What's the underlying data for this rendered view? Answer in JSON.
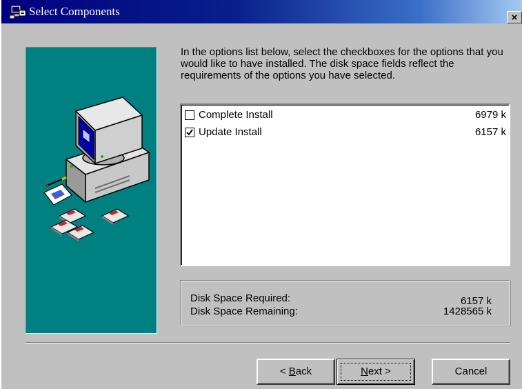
{
  "window": {
    "title": "Select Components",
    "close_label": "×",
    "icon": "installer-app-icon"
  },
  "instructions": "In the options list below, select the checkboxes for the options that you would like to have installed.  The disk space fields reflect the requirements of the options you have selected.",
  "components": [
    {
      "label": "Complete Install",
      "size": "6979 k",
      "checked": false
    },
    {
      "label": "Update Install",
      "size": "6157 k",
      "checked": true
    }
  ],
  "disk_space": {
    "required_label": "Disk Space Required:",
    "required_value": "6157 k",
    "remaining_label": "Disk Space Remaining:",
    "remaining_value": "1428565 k"
  },
  "buttons": {
    "back_prefix": "< ",
    "back_hotkey": "B",
    "back_rest": "ack",
    "next_hotkey": "N",
    "next_rest": "ext >",
    "cancel": "Cancel"
  },
  "colors": {
    "titlebar_start": "#000080",
    "titlebar_end": "#a6caf0",
    "panel": "#008080",
    "face": "#c0c0c0"
  }
}
